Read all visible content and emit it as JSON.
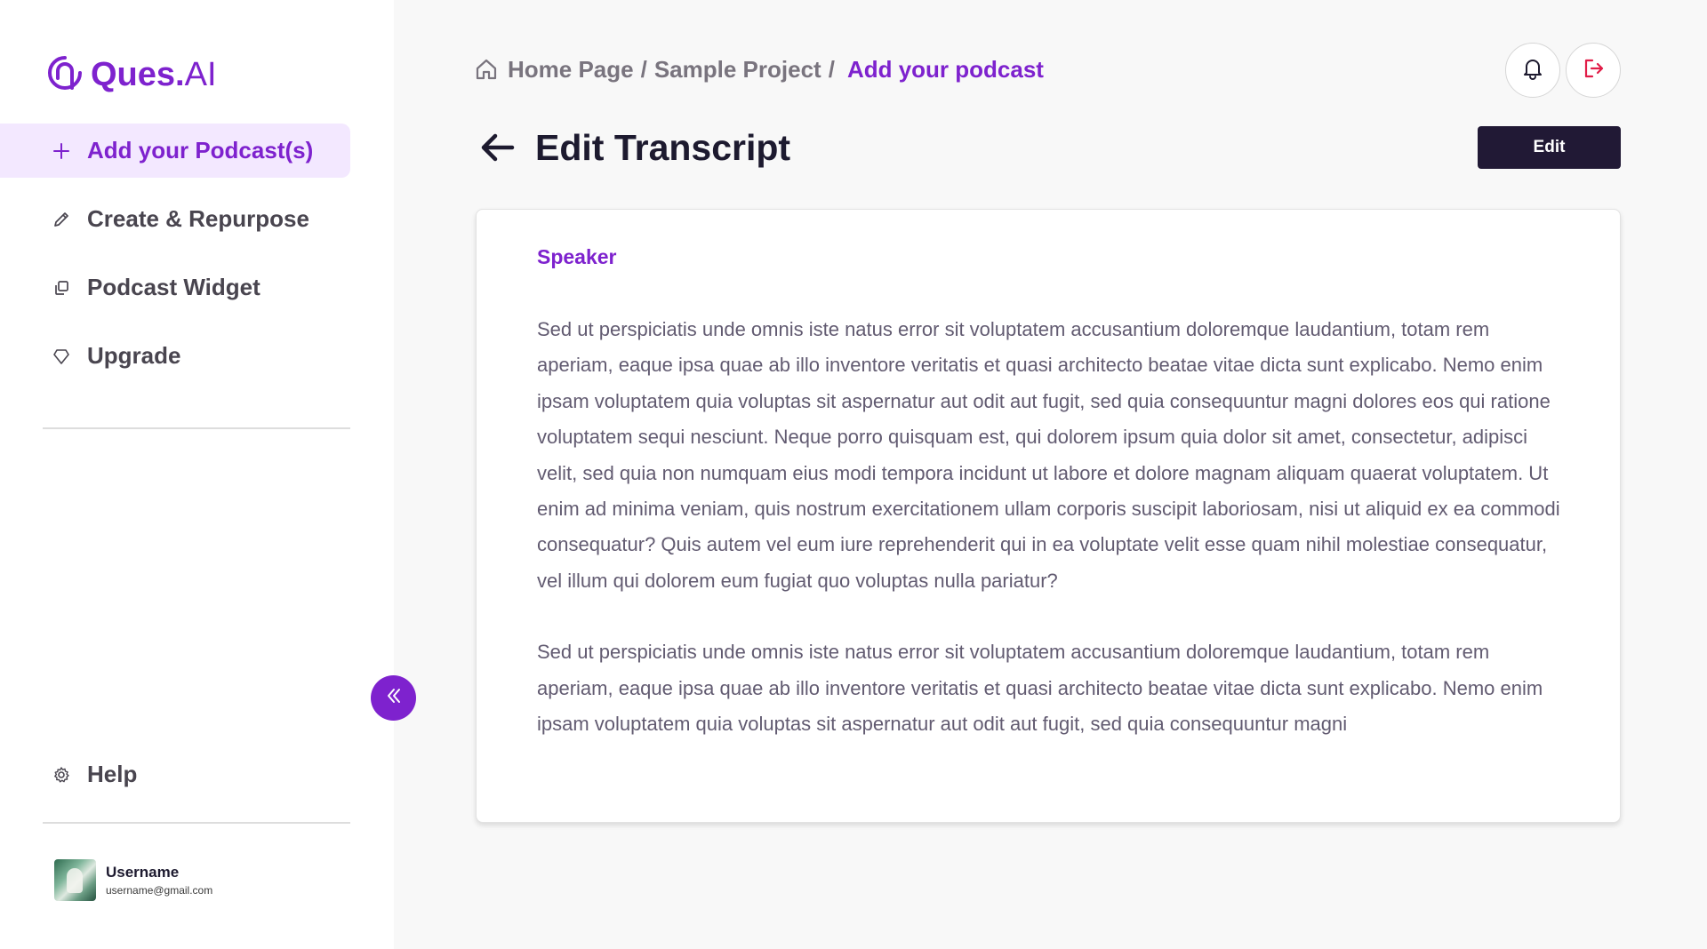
{
  "brand": {
    "name_bold": "Ques.",
    "name_light": "AI",
    "color": "#7e22ce"
  },
  "sidebar": {
    "items": [
      {
        "label": "Add your Podcast(s)",
        "icon": "plus-icon",
        "active": true
      },
      {
        "label": "Create & Repurpose",
        "icon": "pencil-icon",
        "active": false
      },
      {
        "label": "Podcast Widget",
        "icon": "copy-icon",
        "active": false
      },
      {
        "label": "Upgrade",
        "icon": "diamond-icon",
        "active": false
      }
    ],
    "help_label": "Help",
    "help_icon": "gear-icon",
    "collapse_icon": "double-chevron-left-icon"
  },
  "user": {
    "name": "Username",
    "email": "username@gmail.com"
  },
  "breadcrumb": {
    "home_icon": "home-icon",
    "items": [
      "Home Page",
      "Sample Project"
    ],
    "separator": "/",
    "current": "Add your podcast"
  },
  "header": {
    "notification_icon": "bell-icon",
    "logout_icon": "logout-icon",
    "page_title": "Edit Transcript",
    "back_icon": "arrow-left-icon",
    "edit_label": "Edit"
  },
  "transcript": {
    "speaker": "Speaker",
    "paragraphs": [
      "Sed ut perspiciatis unde omnis iste natus error sit voluptatem accusantium doloremque laudantium, totam rem aperiam, eaque ipsa quae ab illo inventore veritatis et quasi architecto beatae vitae dicta sunt explicabo. Nemo enim ipsam voluptatem quia voluptas sit aspernatur aut odit aut fugit, sed quia consequuntur magni dolores eos qui ratione voluptatem sequi nesciunt. Neque porro quisquam est, qui dolorem ipsum quia dolor sit amet, consectetur, adipisci velit, sed quia non numquam eius modi tempora incidunt ut labore et dolore magnam aliquam quaerat voluptatem. Ut enim ad minima veniam, quis nostrum exercitationem ullam corporis suscipit laboriosam, nisi ut aliquid ex ea commodi consequatur? Quis autem vel eum iure reprehenderit qui in ea voluptate velit esse quam nihil molestiae consequatur, vel illum qui dolorem eum fugiat quo voluptas nulla pariatur?",
      "Sed ut perspiciatis unde omnis iste natus error sit voluptatem accusantium doloremque laudantium, totam rem aperiam, eaque ipsa quae ab illo inventore veritatis et quasi architecto beatae vitae dicta sunt explicabo. Nemo enim ipsam voluptatem quia voluptas sit aspernatur aut odit aut fugit, sed quia consequuntur magni"
    ]
  },
  "colors": {
    "accent": "#7e22ce",
    "accent_bg": "#f3e8ff",
    "dark_button": "#211935",
    "logout_red": "#e11d48"
  }
}
